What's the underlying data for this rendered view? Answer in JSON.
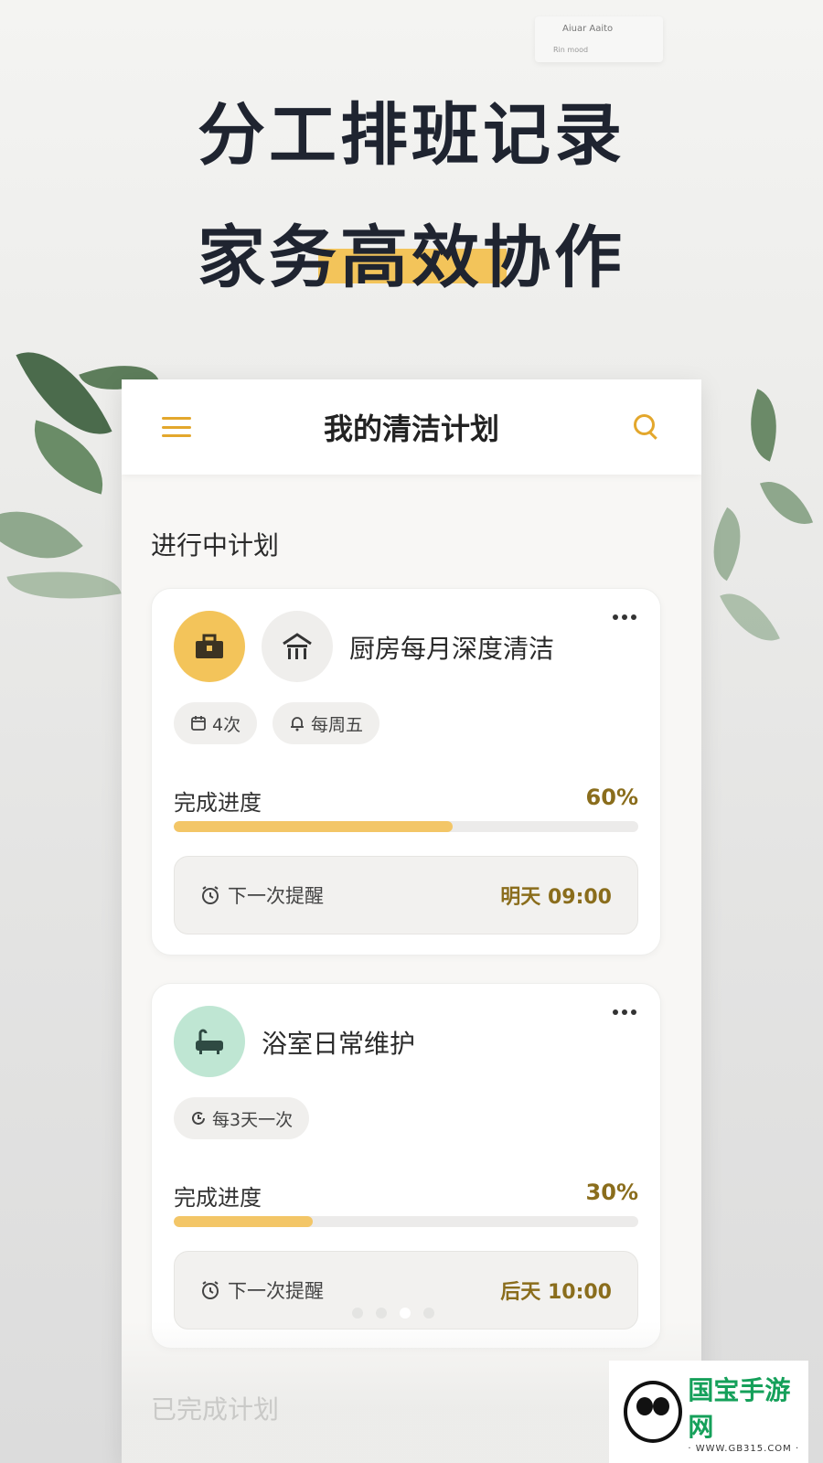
{
  "hero": {
    "line1": "分工排班记录",
    "line2": "家务高效协作"
  },
  "bg_note": {
    "line1": "Aiuar Aaito",
    "line2": "Rin mood"
  },
  "app": {
    "title": "我的清洁计划",
    "section_active": "进行中计划",
    "section_done": "已完成计划"
  },
  "plans": [
    {
      "name": "厨房每月深度清洁",
      "chips": [
        "4次",
        "每周五"
      ],
      "progress_label": "完成进度",
      "progress_text": "60%",
      "progress": 0.6,
      "reminder_label": "下一次提醒",
      "reminder_time": "明天 09:00",
      "icons": [
        "toolbox-icon",
        "house-icon"
      ],
      "icon_colors": [
        "#f3c45a",
        "#efeeec"
      ]
    },
    {
      "name": "浴室日常维护",
      "chips": [
        "每3天一次"
      ],
      "progress_label": "完成进度",
      "progress_text": "30%",
      "progress": 0.3,
      "reminder_label": "下一次提醒",
      "reminder_time": "后天 10:00",
      "icons": [
        "bathtub-icon"
      ],
      "icon_colors": [
        "#bfe6d3"
      ]
    }
  ],
  "pager": {
    "count": 4,
    "active": 2
  },
  "watermark": {
    "name": "国宝手游网",
    "url": "· WWW.GB315.COM ·"
  },
  "colors": {
    "accent": "#e3a72c",
    "progress": "#f3c667",
    "value": "#8a6d1c"
  }
}
